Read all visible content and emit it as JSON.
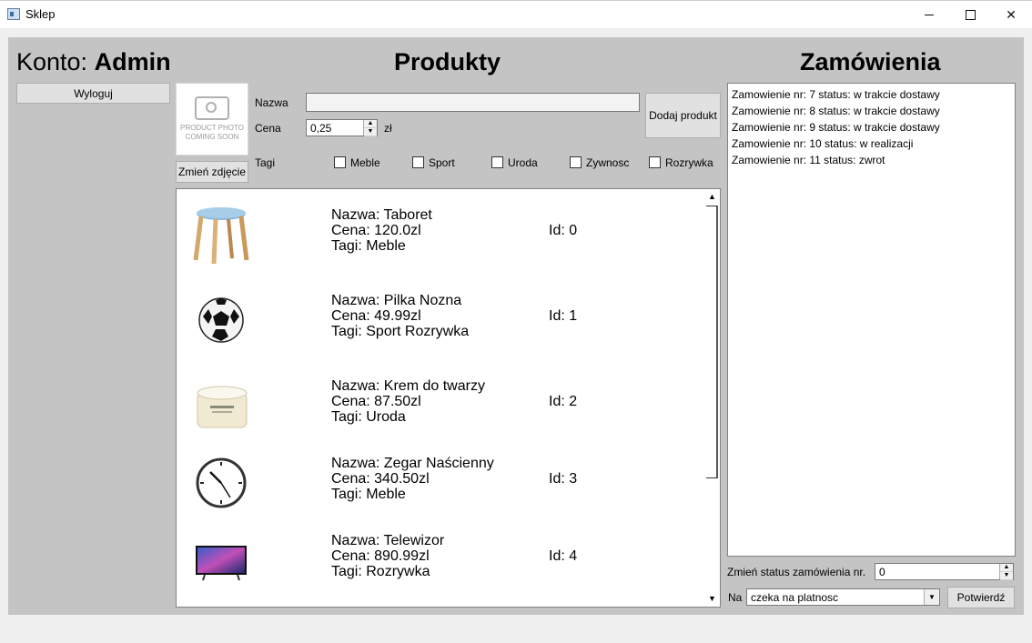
{
  "window": {
    "title": "Sklep"
  },
  "account": {
    "prefix": "Konto:",
    "name": "Admin",
    "logout_label": "Wyloguj"
  },
  "products_section": {
    "heading": "Produkty",
    "photo_placeholder": [
      "PRODUCT PHOTO",
      "COMING SOON"
    ],
    "change_photo_label": "Zmień zdjęcie",
    "name_label": "Nazwa",
    "name_value": "",
    "price_label": "Cena",
    "price_value": "0,25",
    "currency": "zł",
    "add_label": "Dodaj produkt",
    "tags_label": "Tagi",
    "tags": [
      {
        "label": "Meble",
        "checked": false
      },
      {
        "label": "Sport",
        "checked": false
      },
      {
        "label": "Uroda",
        "checked": false
      },
      {
        "label": "Zywnosc",
        "checked": false
      },
      {
        "label": "Rozrywka",
        "checked": false
      }
    ],
    "items": [
      {
        "image": "stool-image",
        "name": "Nazwa: Taboret",
        "price": "Cena:  120.0zl",
        "tags": "Tagi: Meble",
        "id": "Id: 0"
      },
      {
        "image": "soccer-ball-image",
        "name": "Nazwa: Pilka Nozna",
        "price": "Cena:  49.99zl",
        "tags": "Tagi: Sport Rozrywka",
        "id": "Id: 1"
      },
      {
        "image": "face-cream-image",
        "name": "Nazwa: Krem do twarzy",
        "price": "Cena:  87.50zl",
        "tags": "Tagi: Uroda",
        "id": "Id: 2"
      },
      {
        "image": "wall-clock-image",
        "name": "Nazwa: Zegar Naścienny",
        "price": "Cena:  340.50zl",
        "tags": "Tagi: Meble",
        "id": "Id: 3"
      },
      {
        "image": "television-image",
        "name": "Nazwa: Telewizor",
        "price": "Cena:  890.99zl",
        "tags": "Tagi: Rozrywka",
        "id": "Id: 4"
      }
    ]
  },
  "orders_section": {
    "heading": "Zamówienia",
    "orders": [
      "Zamowienie nr: 7 status: w trakcie dostawy",
      "Zamowienie nr: 8 status: w trakcie dostawy",
      "Zamowienie nr: 9 status: w trakcie dostawy",
      "Zamowienie nr: 10 status: w realizacji",
      "Zamowienie nr: 11 status: zwrot"
    ],
    "change_status_label": "Zmień status zamówienia nr.",
    "order_number_value": "0",
    "to_label": "Na",
    "status_selected": "czeka na platnosc",
    "confirm_label": "Potwierdź"
  },
  "colors": {
    "panel_bg": "#c4c4c4",
    "window_bg": "#f0f0f0",
    "button_bg": "#e1e1e1"
  }
}
